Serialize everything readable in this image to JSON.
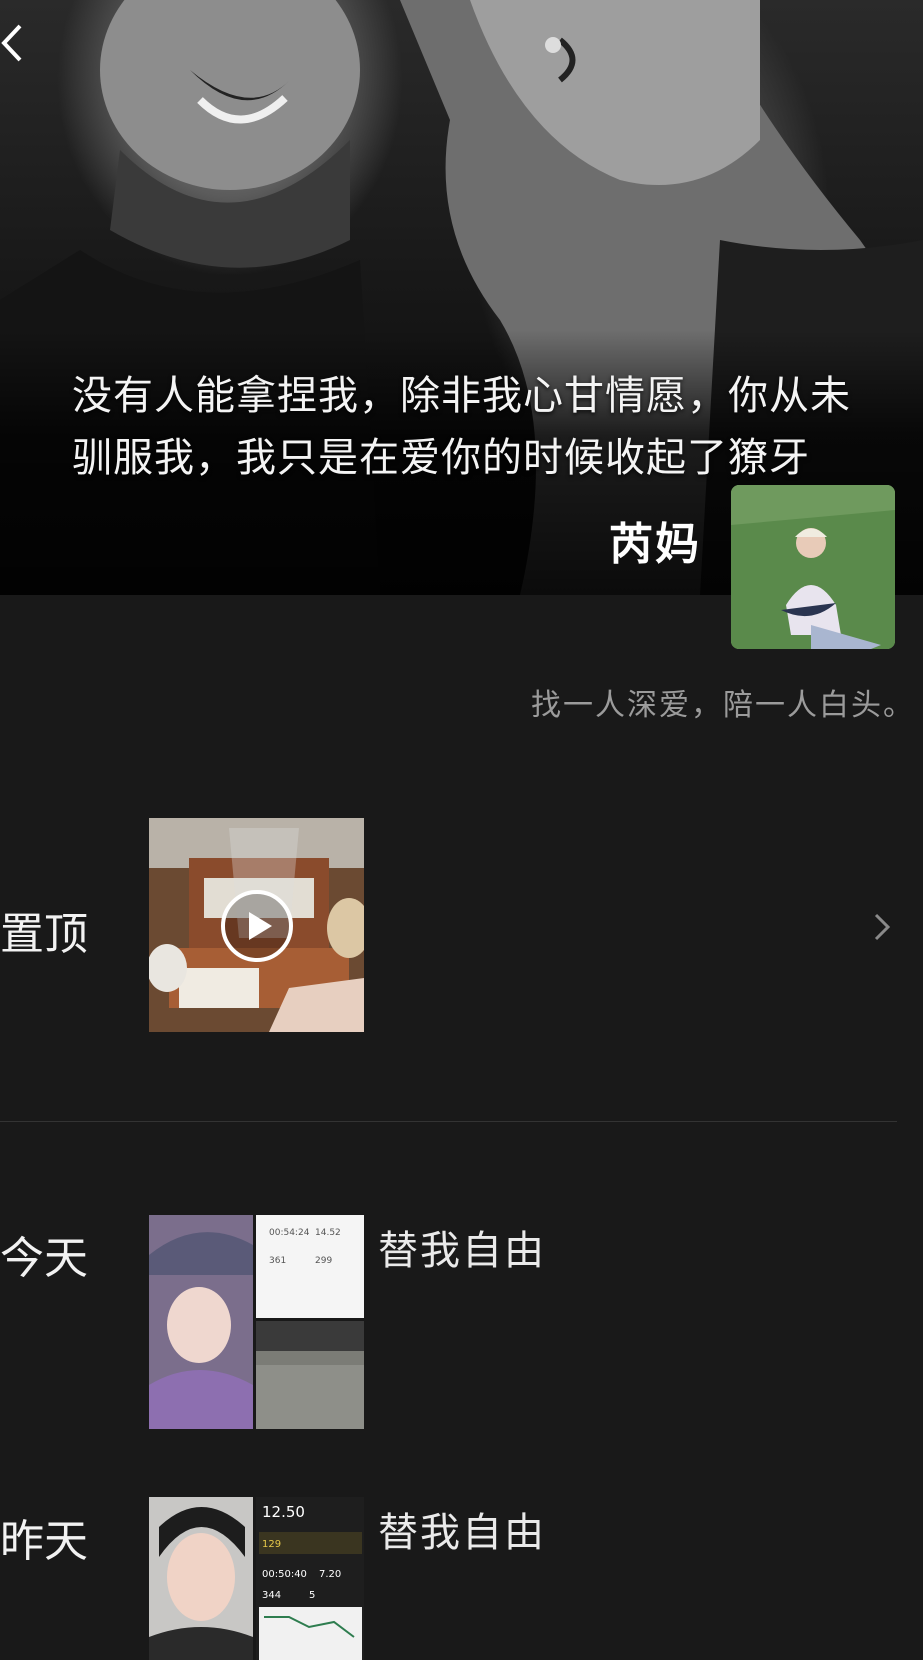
{
  "cover": {
    "quote_line1": "没有人能拿捏我，除非我心甘情愿，你从未",
    "quote_line2": "驯服我，我只是在爱你的时候收起了獠牙"
  },
  "profile": {
    "name": "芮妈",
    "signature": "找一人深爱，陪一人白头。"
  },
  "posts": {
    "pinned": {
      "label": "置顶"
    },
    "today": {
      "label": "今天",
      "text": "替我自由"
    },
    "yesterday": {
      "label": "昨天",
      "text": "替我自由",
      "screenshot": {
        "distance": "12.50",
        "pace": "129",
        "duration": "00:50:40",
        "speed": "7.20",
        "steps": "344",
        "count": "5"
      }
    },
    "stats_card": {
      "time": "00:54:24",
      "value": "14.52",
      "cal": "361",
      "other": "299"
    }
  },
  "icons": {
    "back": "back-arrow-icon",
    "play": "play-icon",
    "chevron": "chevron-right-icon"
  }
}
